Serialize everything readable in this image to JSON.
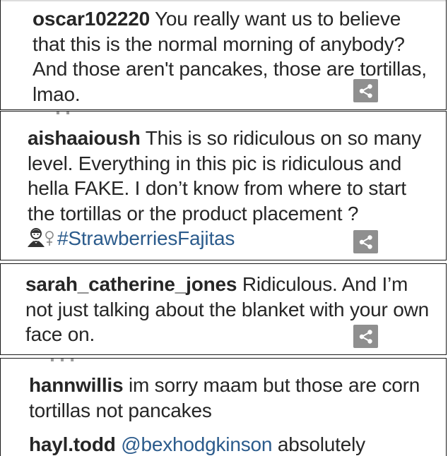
{
  "comments": [
    {
      "username": "oscar102220",
      "text": " You really want us to believe that this is the normal morning of anybody? And those aren't pancakes, those are tortillas, lmao."
    },
    {
      "username": "aishaaioush",
      "text": " This is so ridiculous on so many level. Everything in this pic is ridiculous and hella FAKE. I don’t know from where to start the tortillas or the product placement ?",
      "emoji": "🙎‍♀",
      "hashtag": "#StrawberriesFajitas"
    },
    {
      "username": "sarah_catherine_jones",
      "text": " Ridiculous. And I’m not just talking about the blanket with your own face on."
    },
    {
      "username": "hannwillis",
      "text": " im sorry maam but those are corn tortillas not pancakes"
    },
    {
      "username": "hayl.todd",
      "mention": "@bexhodgkinson",
      "text": " absolutely"
    }
  ],
  "icons": {
    "share": "share-icon",
    "emoji": "woman-pouting-emoji-icon"
  },
  "colors": {
    "text": "#262626",
    "link": "#2b5b8c",
    "share_button": "#8f8f8f",
    "border": "#1a1a1a"
  }
}
